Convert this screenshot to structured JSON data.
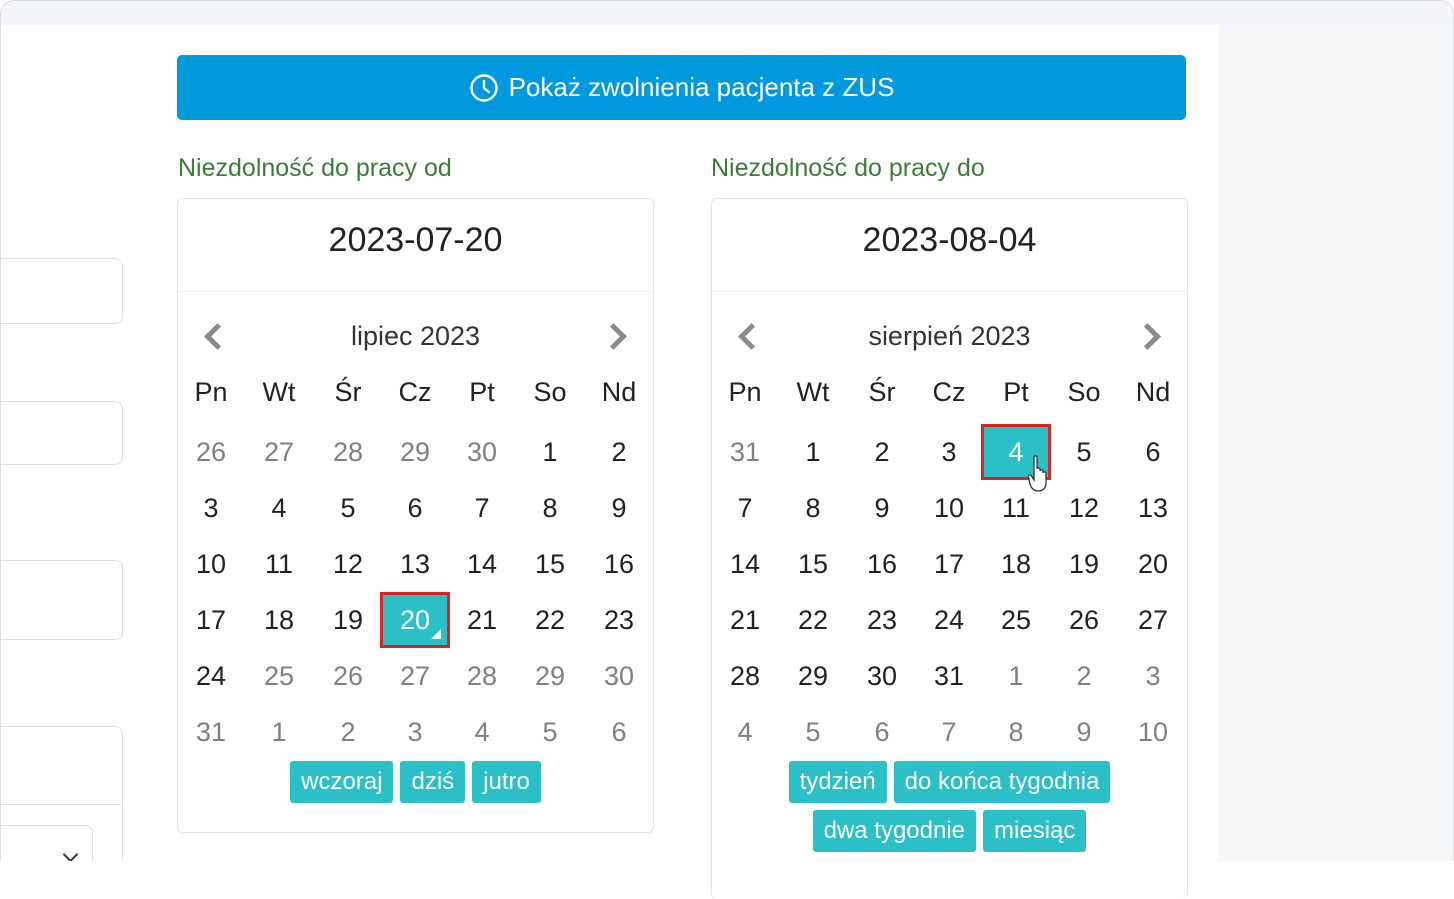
{
  "top_button": {
    "label": "Pokaż zwolnienia pacjenta z ZUS",
    "icon": "clock-icon"
  },
  "from": {
    "label": "Niezdolność do pracy od",
    "selected_date": "2023-07-20",
    "month_title": "lipiec 2023",
    "weekdays": [
      "Pn",
      "Wt",
      "Śr",
      "Cz",
      "Pt",
      "So",
      "Nd"
    ],
    "weeks": [
      [
        {
          "d": "26",
          "m": 1
        },
        {
          "d": "27",
          "m": 1
        },
        {
          "d": "28",
          "m": 1
        },
        {
          "d": "29",
          "m": 1
        },
        {
          "d": "30",
          "m": 1
        },
        {
          "d": "1",
          "m": 0
        },
        {
          "d": "2",
          "m": 0
        }
      ],
      [
        {
          "d": "3",
          "m": 0
        },
        {
          "d": "4",
          "m": 0
        },
        {
          "d": "5",
          "m": 0
        },
        {
          "d": "6",
          "m": 0
        },
        {
          "d": "7",
          "m": 0
        },
        {
          "d": "8",
          "m": 0
        },
        {
          "d": "9",
          "m": 0
        }
      ],
      [
        {
          "d": "10",
          "m": 0
        },
        {
          "d": "11",
          "m": 0
        },
        {
          "d": "12",
          "m": 0
        },
        {
          "d": "13",
          "m": 0
        },
        {
          "d": "14",
          "m": 0
        },
        {
          "d": "15",
          "m": 0
        },
        {
          "d": "16",
          "m": 0
        }
      ],
      [
        {
          "d": "17",
          "m": 0
        },
        {
          "d": "18",
          "m": 0
        },
        {
          "d": "19",
          "m": 0
        },
        {
          "d": "20",
          "m": 0,
          "sel": 1
        },
        {
          "d": "21",
          "m": 0
        },
        {
          "d": "22",
          "m": 0
        },
        {
          "d": "23",
          "m": 0
        }
      ],
      [
        {
          "d": "24",
          "m": 0
        },
        {
          "d": "25",
          "m": 1
        },
        {
          "d": "26",
          "m": 1
        },
        {
          "d": "27",
          "m": 1
        },
        {
          "d": "28",
          "m": 1
        },
        {
          "d": "29",
          "m": 1
        },
        {
          "d": "30",
          "m": 1
        }
      ],
      [
        {
          "d": "31",
          "m": 1
        },
        {
          "d": "1",
          "m": 1
        },
        {
          "d": "2",
          "m": 1
        },
        {
          "d": "3",
          "m": 1
        },
        {
          "d": "4",
          "m": 1
        },
        {
          "d": "5",
          "m": 1
        },
        {
          "d": "6",
          "m": 1
        }
      ]
    ],
    "quick_rows": [
      [
        "wczoraj",
        "dziś",
        "jutro"
      ]
    ]
  },
  "to": {
    "label": "Niezdolność do pracy do",
    "selected_date": "2023-08-04",
    "month_title": "sierpień 2023",
    "weekdays": [
      "Pn",
      "Wt",
      "Śr",
      "Cz",
      "Pt",
      "So",
      "Nd"
    ],
    "weeks": [
      [
        {
          "d": "31",
          "m": 1
        },
        {
          "d": "1",
          "m": 0
        },
        {
          "d": "2",
          "m": 0
        },
        {
          "d": "3",
          "m": 0
        },
        {
          "d": "4",
          "m": 0,
          "sel": 1
        },
        {
          "d": "5",
          "m": 0
        },
        {
          "d": "6",
          "m": 0
        }
      ],
      [
        {
          "d": "7",
          "m": 0
        },
        {
          "d": "8",
          "m": 0
        },
        {
          "d": "9",
          "m": 0
        },
        {
          "d": "10",
          "m": 0
        },
        {
          "d": "11",
          "m": 0
        },
        {
          "d": "12",
          "m": 0
        },
        {
          "d": "13",
          "m": 0
        }
      ],
      [
        {
          "d": "14",
          "m": 0
        },
        {
          "d": "15",
          "m": 0
        },
        {
          "d": "16",
          "m": 0
        },
        {
          "d": "17",
          "m": 0
        },
        {
          "d": "18",
          "m": 0
        },
        {
          "d": "19",
          "m": 0
        },
        {
          "d": "20",
          "m": 0
        }
      ],
      [
        {
          "d": "21",
          "m": 0
        },
        {
          "d": "22",
          "m": 0
        },
        {
          "d": "23",
          "m": 0
        },
        {
          "d": "24",
          "m": 0
        },
        {
          "d": "25",
          "m": 0
        },
        {
          "d": "26",
          "m": 0
        },
        {
          "d": "27",
          "m": 0
        }
      ],
      [
        {
          "d": "28",
          "m": 0
        },
        {
          "d": "29",
          "m": 0
        },
        {
          "d": "30",
          "m": 0
        },
        {
          "d": "31",
          "m": 0
        },
        {
          "d": "1",
          "m": 1
        },
        {
          "d": "2",
          "m": 1
        },
        {
          "d": "3",
          "m": 1
        }
      ],
      [
        {
          "d": "4",
          "m": 1
        },
        {
          "d": "5",
          "m": 1
        },
        {
          "d": "6",
          "m": 1
        },
        {
          "d": "7",
          "m": 1
        },
        {
          "d": "8",
          "m": 1
        },
        {
          "d": "9",
          "m": 1
        },
        {
          "d": "10",
          "m": 1
        }
      ]
    ],
    "quick_rows": [
      [
        "tydzień",
        "do końca tygodnia"
      ],
      [
        "dwa tygodnie",
        "miesiąc"
      ]
    ]
  },
  "colors": {
    "primary_button": "#0099de",
    "accent_teal": "#2bc0c8",
    "label_green": "#3a7d39",
    "highlight_red": "#d62727",
    "muted_day": "#808080"
  }
}
